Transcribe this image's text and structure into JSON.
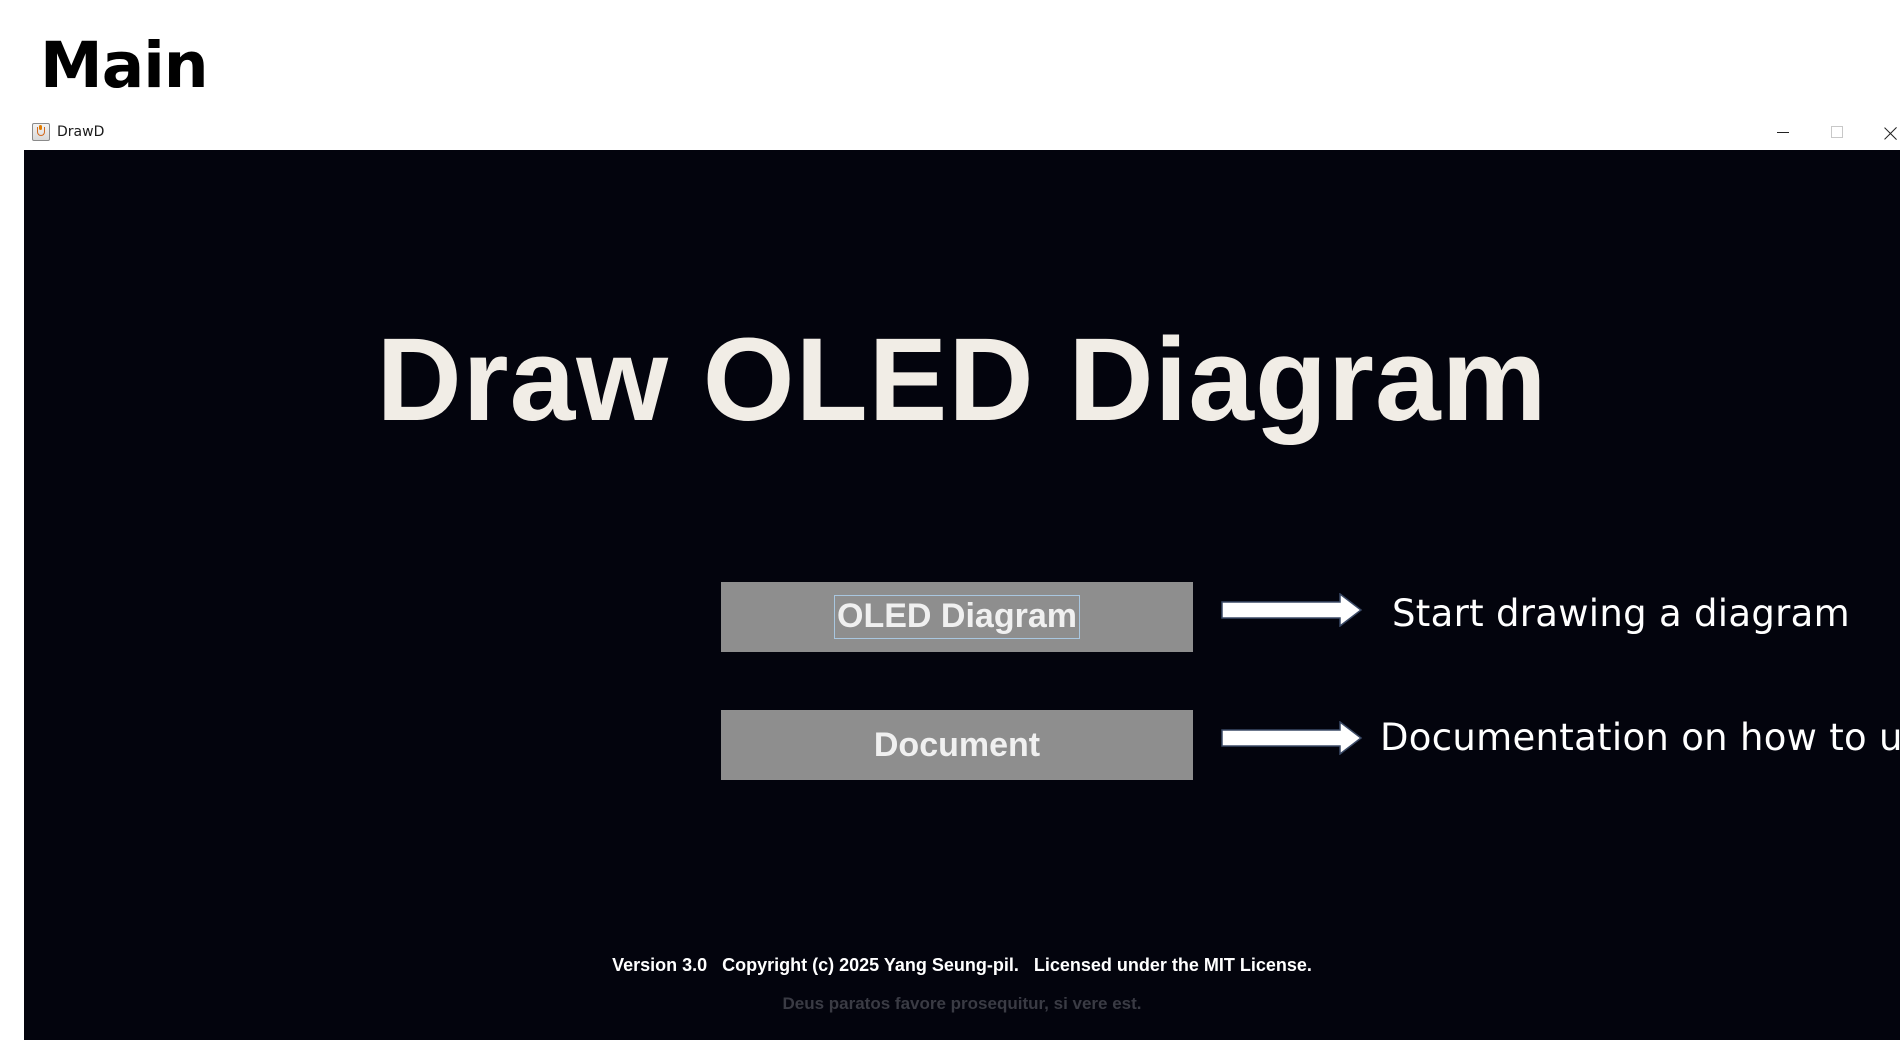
{
  "page": {
    "heading": "Main"
  },
  "window": {
    "title": "DrawD",
    "icon": "java-app-icon",
    "controls": [
      "minimize-icon",
      "maximize-icon",
      "close-icon"
    ]
  },
  "app": {
    "title": "Draw OLED Diagram",
    "buttons": {
      "oled_diagram": "OLED Diagram",
      "document": "Document"
    },
    "footer": {
      "version_line": "Version 3.0   Copyright (c) 2025 Yang Seung-pil.   Licensed under the MIT License.",
      "motto": "Deus paratos favore prosequitur, si vere est."
    }
  },
  "annotations": {
    "oled_diagram": "Start drawing a diagram",
    "document": "Documentation on how to use"
  },
  "colors": {
    "app_background": "#03040d",
    "title_text": "#f1ede6",
    "button_background": "#8e8e8e",
    "button_text": "#f0f0f0",
    "motto_text": "#3a3b44"
  }
}
